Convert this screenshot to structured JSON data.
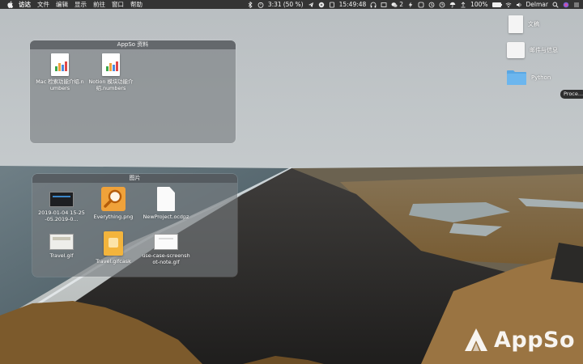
{
  "menubar": {
    "app_name": "访达",
    "menus": [
      "文件",
      "编辑",
      "显示",
      "前往",
      "窗口",
      "帮助"
    ],
    "status": {
      "timer": "3:31",
      "battery_percent_text": "(50 %)",
      "clock": "15:49:48",
      "wechat_count": "2",
      "battery_level": "100%",
      "user": "Delmar"
    }
  },
  "stacks": {
    "appso": {
      "title": "AppSo 资料",
      "files": [
        {
          "name": "Mac 检索功能介绍.numbers",
          "icon": "numbers-doc-icon"
        },
        {
          "name": "Notion 模块功能介绍.numbers",
          "icon": "numbers-doc-icon"
        }
      ]
    },
    "pictures": {
      "title": "图片",
      "files": [
        {
          "name": "2019-01-04 15-25-05.2019-0...",
          "icon": "screenshot-thumb-icon"
        },
        {
          "name": "Everything.png",
          "icon": "everything-app-icon"
        },
        {
          "name": "NewProject.ocdpz",
          "icon": "blank-doc-icon"
        },
        {
          "name": "Travel.gif",
          "icon": "gif-thumb-icon"
        },
        {
          "name": "Travel.gifcask",
          "icon": "gifcask-doc-icon"
        },
        {
          "name": "use-case-screenshot-note.gif",
          "icon": "gif-thumb-icon"
        }
      ]
    }
  },
  "desktop": {
    "icons": [
      {
        "name": "文稿",
        "icon": "document-icon"
      },
      {
        "name": "邮件与信息",
        "icon": "document-icon"
      },
      {
        "name": "Python",
        "icon": "folder-icon"
      }
    ],
    "tooltip": "Proce..."
  },
  "watermark": {
    "text": "AppSo"
  },
  "colors": {
    "menubar": "#2a2a2a",
    "folder_blue": "#5aa7e3",
    "everything_orange": "#f0a23a",
    "numbers_green": "#3aa54a"
  }
}
